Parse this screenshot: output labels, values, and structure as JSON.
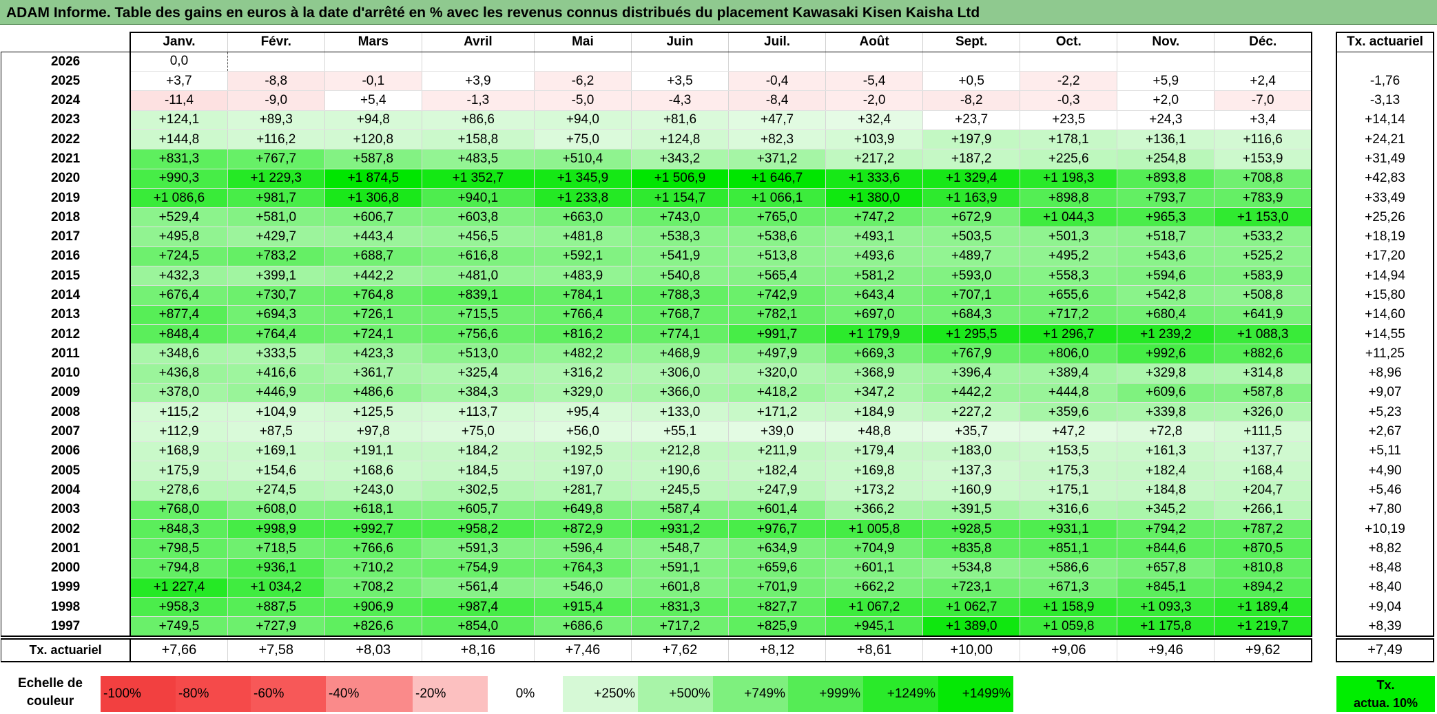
{
  "title": "ADAM Informe. Table des gains en euros à la date d'arrêté en % avec les revenus connus distribués du placement Kawasaki Kisen Kaisha Ltd",
  "months": [
    "Janv.",
    "Févr.",
    "Mars",
    "Avril",
    "Mai",
    "Juin",
    "Juil.",
    "Août",
    "Sept.",
    "Oct.",
    "Nov.",
    "Déc."
  ],
  "actuarial_header": "Tx. actuariel",
  "rows": [
    {
      "year": "2026",
      "values": [
        "0,0",
        "",
        "",
        "",
        "",
        "",
        "",
        "",
        "",
        "",
        "",
        ""
      ],
      "act": ""
    },
    {
      "year": "2025",
      "values": [
        "+3,7",
        "-8,8",
        "-0,1",
        "+3,9",
        "-6,2",
        "+3,5",
        "-0,4",
        "-5,4",
        "+0,5",
        "-2,2",
        "+5,9",
        "+2,4"
      ],
      "act": "-1,76"
    },
    {
      "year": "2024",
      "values": [
        "-11,4",
        "-9,0",
        "+5,4",
        "-1,3",
        "-5,0",
        "-4,3",
        "-8,4",
        "-2,0",
        "-8,2",
        "-0,3",
        "+2,0",
        "-7,0"
      ],
      "act": "-3,13"
    },
    {
      "year": "2023",
      "values": [
        "+124,1",
        "+89,3",
        "+94,8",
        "+86,6",
        "+94,0",
        "+81,6",
        "+47,7",
        "+32,4",
        "+23,7",
        "+23,5",
        "+24,3",
        "+3,4"
      ],
      "act": "+14,14"
    },
    {
      "year": "2022",
      "values": [
        "+144,8",
        "+116,2",
        "+120,8",
        "+158,8",
        "+75,0",
        "+124,8",
        "+82,3",
        "+103,9",
        "+197,9",
        "+178,1",
        "+136,1",
        "+116,6"
      ],
      "act": "+24,21"
    },
    {
      "year": "2021",
      "values": [
        "+831,3",
        "+767,7",
        "+587,8",
        "+483,5",
        "+510,4",
        "+343,2",
        "+371,2",
        "+217,2",
        "+187,2",
        "+225,6",
        "+254,8",
        "+153,9"
      ],
      "act": "+31,49"
    },
    {
      "year": "2020",
      "values": [
        "+990,3",
        "+1 229,3",
        "+1 874,5",
        "+1 352,7",
        "+1 345,9",
        "+1 506,9",
        "+1 646,7",
        "+1 333,6",
        "+1 329,4",
        "+1 198,3",
        "+893,8",
        "+708,8"
      ],
      "act": "+42,83"
    },
    {
      "year": "2019",
      "values": [
        "+1 086,6",
        "+981,7",
        "+1 306,8",
        "+940,1",
        "+1 233,8",
        "+1 154,7",
        "+1 066,1",
        "+1 380,0",
        "+1 163,9",
        "+898,8",
        "+793,7",
        "+783,9"
      ],
      "act": "+33,49"
    },
    {
      "year": "2018",
      "values": [
        "+529,4",
        "+581,0",
        "+606,7",
        "+603,8",
        "+663,0",
        "+743,0",
        "+765,0",
        "+747,2",
        "+672,9",
        "+1 044,3",
        "+965,3",
        "+1 153,0"
      ],
      "act": "+25,26"
    },
    {
      "year": "2017",
      "values": [
        "+495,8",
        "+429,7",
        "+443,4",
        "+456,5",
        "+481,8",
        "+538,3",
        "+538,6",
        "+493,1",
        "+503,5",
        "+501,3",
        "+518,7",
        "+533,2"
      ],
      "act": "+18,19"
    },
    {
      "year": "2016",
      "values": [
        "+724,5",
        "+783,2",
        "+688,7",
        "+616,8",
        "+592,1",
        "+541,9",
        "+513,8",
        "+493,6",
        "+489,7",
        "+495,2",
        "+543,6",
        "+525,2"
      ],
      "act": "+17,20"
    },
    {
      "year": "2015",
      "values": [
        "+432,3",
        "+399,1",
        "+442,2",
        "+481,0",
        "+483,9",
        "+540,8",
        "+565,4",
        "+581,2",
        "+593,0",
        "+558,3",
        "+594,6",
        "+583,9"
      ],
      "act": "+14,94"
    },
    {
      "year": "2014",
      "values": [
        "+676,4",
        "+730,7",
        "+764,8",
        "+839,1",
        "+784,1",
        "+788,3",
        "+742,9",
        "+643,4",
        "+707,1",
        "+655,6",
        "+542,8",
        "+508,8"
      ],
      "act": "+15,80"
    },
    {
      "year": "2013",
      "values": [
        "+877,4",
        "+694,3",
        "+726,1",
        "+715,5",
        "+766,4",
        "+768,7",
        "+782,1",
        "+697,0",
        "+684,3",
        "+717,2",
        "+680,4",
        "+641,9"
      ],
      "act": "+14,60"
    },
    {
      "year": "2012",
      "values": [
        "+848,4",
        "+764,4",
        "+724,1",
        "+756,6",
        "+816,2",
        "+774,1",
        "+991,7",
        "+1 179,9",
        "+1 295,5",
        "+1 296,7",
        "+1 239,2",
        "+1 088,3"
      ],
      "act": "+14,55"
    },
    {
      "year": "2011",
      "values": [
        "+348,6",
        "+333,5",
        "+423,3",
        "+513,0",
        "+482,2",
        "+468,9",
        "+497,9",
        "+669,3",
        "+767,9",
        "+806,0",
        "+992,6",
        "+882,6"
      ],
      "act": "+11,25"
    },
    {
      "year": "2010",
      "values": [
        "+436,8",
        "+416,6",
        "+361,7",
        "+325,4",
        "+316,2",
        "+306,0",
        "+320,0",
        "+368,9",
        "+396,4",
        "+389,4",
        "+329,8",
        "+314,8"
      ],
      "act": "+8,96"
    },
    {
      "year": "2009",
      "values": [
        "+378,0",
        "+446,9",
        "+486,6",
        "+384,3",
        "+329,0",
        "+366,0",
        "+418,2",
        "+347,2",
        "+442,2",
        "+444,8",
        "+609,6",
        "+587,8"
      ],
      "act": "+9,07"
    },
    {
      "year": "2008",
      "values": [
        "+115,2",
        "+104,9",
        "+125,5",
        "+113,7",
        "+95,4",
        "+133,0",
        "+171,2",
        "+184,9",
        "+227,2",
        "+359,6",
        "+339,8",
        "+326,0"
      ],
      "act": "+5,23"
    },
    {
      "year": "2007",
      "values": [
        "+112,9",
        "+87,5",
        "+97,8",
        "+75,0",
        "+56,0",
        "+55,1",
        "+39,0",
        "+48,8",
        "+35,7",
        "+47,2",
        "+72,8",
        "+111,5"
      ],
      "act": "+2,67"
    },
    {
      "year": "2006",
      "values": [
        "+168,9",
        "+169,1",
        "+191,1",
        "+184,2",
        "+192,5",
        "+212,8",
        "+211,9",
        "+179,4",
        "+183,0",
        "+153,5",
        "+161,3",
        "+137,7"
      ],
      "act": "+5,11"
    },
    {
      "year": "2005",
      "values": [
        "+175,9",
        "+154,6",
        "+168,6",
        "+184,5",
        "+197,0",
        "+190,6",
        "+182,4",
        "+169,8",
        "+137,3",
        "+175,3",
        "+182,4",
        "+168,4"
      ],
      "act": "+4,90"
    },
    {
      "year": "2004",
      "values": [
        "+278,6",
        "+274,5",
        "+243,0",
        "+302,5",
        "+281,7",
        "+245,5",
        "+247,9",
        "+173,2",
        "+160,9",
        "+175,1",
        "+184,8",
        "+204,7"
      ],
      "act": "+5,46"
    },
    {
      "year": "2003",
      "values": [
        "+768,0",
        "+608,0",
        "+618,1",
        "+605,7",
        "+649,8",
        "+587,4",
        "+601,4",
        "+366,2",
        "+391,5",
        "+316,6",
        "+345,2",
        "+266,1"
      ],
      "act": "+7,80"
    },
    {
      "year": "2002",
      "values": [
        "+848,3",
        "+998,9",
        "+992,7",
        "+958,2",
        "+872,9",
        "+931,2",
        "+976,7",
        "+1 005,8",
        "+928,5",
        "+931,1",
        "+794,2",
        "+787,2"
      ],
      "act": "+10,19"
    },
    {
      "year": "2001",
      "values": [
        "+798,5",
        "+718,5",
        "+766,6",
        "+591,3",
        "+596,4",
        "+548,7",
        "+634,9",
        "+704,9",
        "+835,8",
        "+851,1",
        "+844,6",
        "+870,5"
      ],
      "act": "+8,82"
    },
    {
      "year": "2000",
      "values": [
        "+794,8",
        "+936,1",
        "+710,2",
        "+754,9",
        "+764,3",
        "+591,1",
        "+659,6",
        "+601,1",
        "+534,8",
        "+586,6",
        "+657,8",
        "+810,8"
      ],
      "act": "+8,48"
    },
    {
      "year": "1999",
      "values": [
        "+1 227,4",
        "+1 034,2",
        "+708,2",
        "+561,4",
        "+546,0",
        "+601,8",
        "+701,9",
        "+662,2",
        "+723,1",
        "+671,3",
        "+845,1",
        "+894,2"
      ],
      "act": "+8,40"
    },
    {
      "year": "1998",
      "values": [
        "+958,3",
        "+887,5",
        "+906,9",
        "+987,4",
        "+915,4",
        "+831,3",
        "+827,7",
        "+1 067,2",
        "+1 062,7",
        "+1 158,9",
        "+1 093,3",
        "+1 189,4"
      ],
      "act": "+9,04"
    },
    {
      "year": "1997",
      "values": [
        "+749,5",
        "+727,9",
        "+826,6",
        "+854,0",
        "+686,6",
        "+717,2",
        "+825,9",
        "+945,1",
        "+1 389,0",
        "+1 059,8",
        "+1 175,8",
        "+1 219,7"
      ],
      "act": "+8,39"
    }
  ],
  "footer": {
    "label": "Tx. actuariel",
    "values": [
      "+7,66",
      "+7,58",
      "+8,03",
      "+8,16",
      "+7,46",
      "+7,62",
      "+8,12",
      "+8,61",
      "+10,00",
      "+9,06",
      "+9,46",
      "+9,62"
    ],
    "act": "+7,49"
  },
  "scale": {
    "label_line1": "Echelle de",
    "label_line2": "couleur",
    "steps": [
      {
        "label": "-100%",
        "color": "#f24040"
      },
      {
        "label": "-80%",
        "color": "#f54a4a"
      },
      {
        "label": "-60%",
        "color": "#f75858"
      },
      {
        "label": "-40%",
        "color": "#fa8a8a"
      },
      {
        "label": "-20%",
        "color": "#fcc0c0"
      },
      {
        "label": "0%",
        "color": "#ffffff"
      },
      {
        "label": "+250%",
        "color": "#d6f9d6"
      },
      {
        "label": "+500%",
        "color": "#a8f4a8"
      },
      {
        "label": "+749%",
        "color": "#7ef07e"
      },
      {
        "label": "+999%",
        "color": "#55ec55"
      },
      {
        "label": "+1249%",
        "color": "#2aea2a"
      },
      {
        "label": "+1499%",
        "color": "#05e805"
      }
    ],
    "act_line1": "Tx.",
    "act_line2": "actua. 10%",
    "act_color": "#00ee00"
  }
}
